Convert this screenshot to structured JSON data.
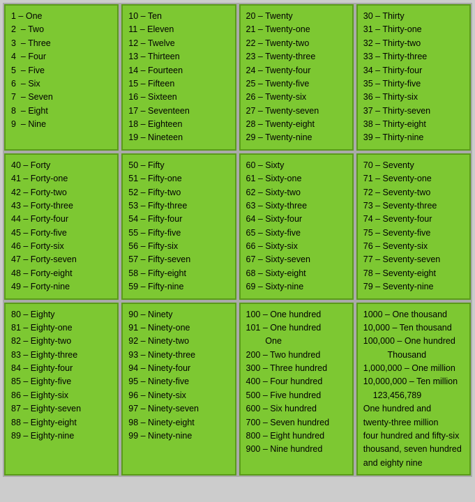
{
  "cells": [
    {
      "id": "cell-1-10",
      "content": "1 – One\n2  – Two\n3  – Three\n4  – Four\n5  – Five\n6  – Six\n7  – Seven\n8  – Eight\n9  – Nine"
    },
    {
      "id": "cell-10-19",
      "content": "10 – Ten\n11 – Eleven\n12 – Twelve\n13 – Thirteen\n14 – Fourteen\n15 – Fifteen\n16 – Sixteen\n17 – Seventeen\n18 – Eighteen\n19 – Nineteen"
    },
    {
      "id": "cell-20-29",
      "content": "20 – Twenty\n21 – Twenty-one\n22 – Twenty-two\n23 – Twenty-three\n24 – Twenty-four\n25 – Twenty-five\n26 – Twenty-six\n27 – Twenty-seven\n28 – Twenty-eight\n29 – Twenty-nine"
    },
    {
      "id": "cell-30-39",
      "content": "30 – Thirty\n31 – Thirty-one\n32 – Thirty-two\n33 – Thirty-three\n34 – Thirty-four\n35 – Thirty-five\n36 – Thirty-six\n37 – Thirty-seven\n38 – Thirty-eight\n39 – Thirty-nine"
    },
    {
      "id": "cell-40-49",
      "content": "40 – Forty\n41 – Forty-one\n42 – Forty-two\n43 – Forty-three\n44 – Forty-four\n45 – Forty-five\n46 – Forty-six\n47 – Forty-seven\n48 – Forty-eight\n49 – Forty-nine"
    },
    {
      "id": "cell-50-59",
      "content": "50 – Fifty\n51 – Fifty-one\n52 – Fifty-two\n53 – Fifty-three\n54 – Fifty-four\n55 – Fifty-five\n56 – Fifty-six\n57 – Fifty-seven\n58 – Fifty-eight\n59 – Fifty-nine"
    },
    {
      "id": "cell-60-69",
      "content": "60 – Sixty\n61 – Sixty-one\n62 – Sixty-two\n63 – Sixty-three\n64 – Sixty-four\n65 – Sixty-five\n66 – Sixty-six\n67 – Sixty-seven\n68 – Sixty-eight\n69 – Sixty-nine"
    },
    {
      "id": "cell-70-79",
      "content": "70 – Seventy\n71 – Seventy-one\n72 – Seventy-two\n73 – Seventy-three\n74 – Seventy-four\n75 – Seventy-five\n76 – Seventy-six\n77 – Seventy-seven\n78 – Seventy-eight\n79 – Seventy-nine"
    },
    {
      "id": "cell-80-89",
      "content": "80 – Eighty\n81 – Eighty-one\n82 – Eighty-two\n83 – Eighty-three\n84 – Eighty-four\n85 – Eighty-five\n86 – Eighty-six\n87 – Eighty-seven\n88 – Eighty-eight\n89 – Eighty-nine"
    },
    {
      "id": "cell-90-99",
      "content": "90 – Ninety\n91 – Ninety-one\n92 – Ninety-two\n93 – Ninety-three\n94 – Ninety-four\n95 – Ninety-five\n96 – Ninety-six\n97 – Ninety-seven\n98 – Ninety-eight\n99 – Ninety-nine"
    },
    {
      "id": "cell-100-900",
      "content": "100 – One hundred\n101 – One hundred\n        One\n200 – Two hundred\n300 – Three hundred\n400 – Four hundred\n500 – Five hundred\n600 – Six hundred\n700 – Seven hundred\n800 – Eight hundred\n900 – Nine hundred"
    },
    {
      "id": "cell-1000-plus",
      "content": "1000 – One thousand\n10,000 – Ten thousand\n100,000 – One hundred\n          Thousand\n1,000,000 – One million\n10,000,000 – Ten million\n    123,456,789\nOne hundred and\ntwenty-three million\nfour hundred and fifty-six\nthousand, seven hundred\nand eighty nine"
    }
  ]
}
